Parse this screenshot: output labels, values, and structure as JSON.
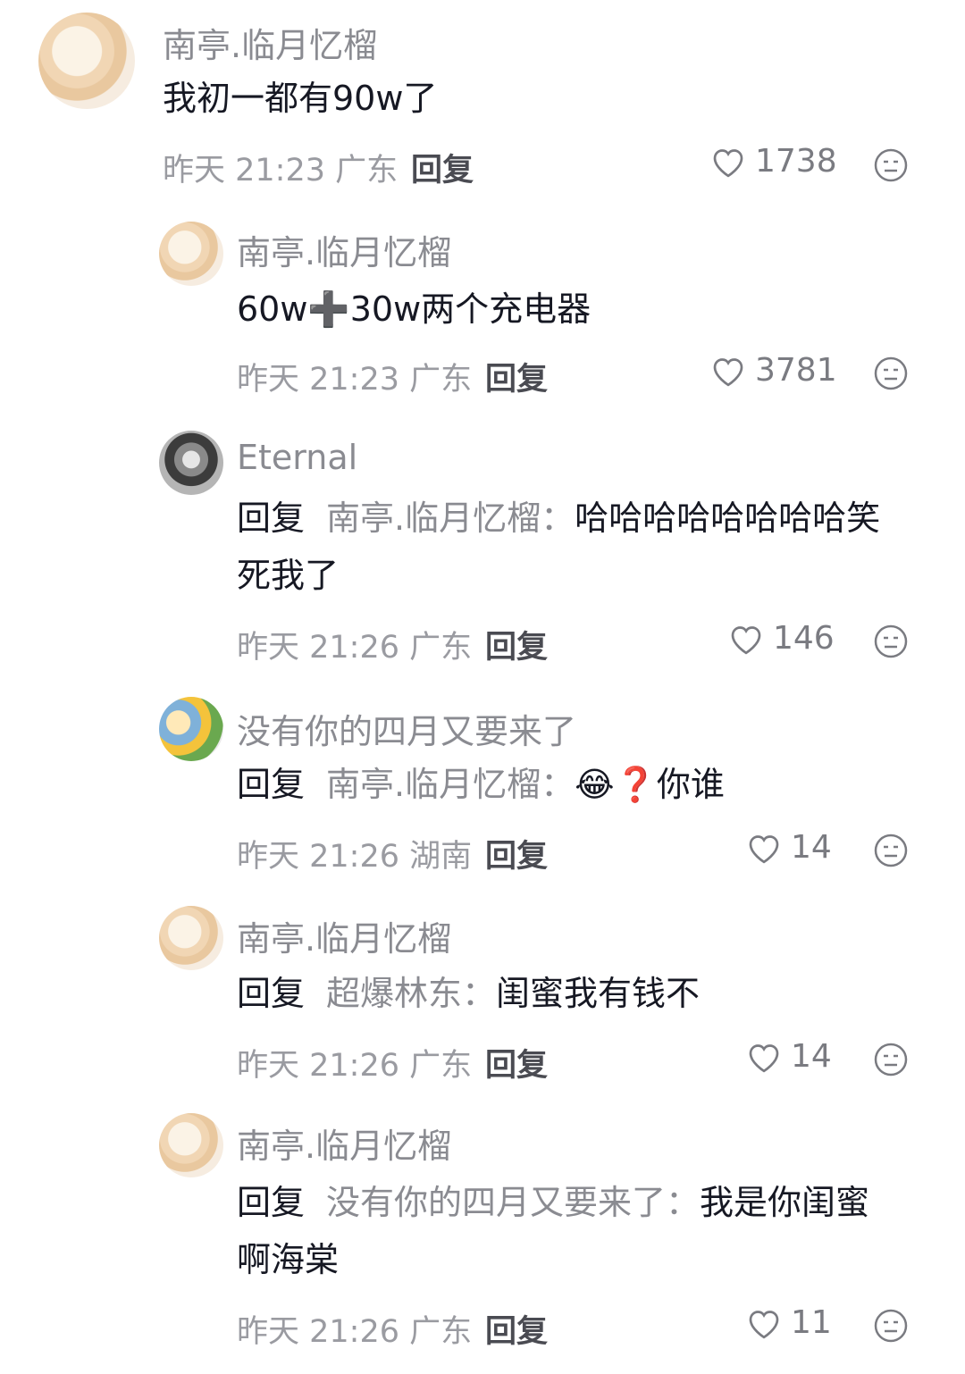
{
  "comments": [
    {
      "username": "南亭.临月忆榴",
      "text": "我初一都有90w了",
      "time_location": "昨天 21:23 广东",
      "reply_label": "回复",
      "likes": "1738",
      "avatar": "anime-girl-avatar"
    },
    {
      "username": "南亭.临月忆榴",
      "text": "60w➕30w两个充电器",
      "time_location": "昨天 21:23 广东",
      "reply_label": "回复",
      "likes": "3781",
      "avatar": "anime-girl-avatar"
    },
    {
      "username": "Eternal",
      "reply_prefix": "回复",
      "reply_target": "南亭.临月忆榴：",
      "text_line1": "哈哈哈哈哈哈哈哈笑",
      "text_line2": "死我了",
      "time_location": "昨天 21:26 广东",
      "reply_label": "回复",
      "likes": "146",
      "avatar": "cat-avatar"
    },
    {
      "username": "没有你的四月又要来了",
      "reply_prefix": "回复",
      "reply_target": "南亭.临月忆榴：",
      "text": "😂❓你谁",
      "time_location": "昨天 21:26 湖南",
      "reply_label": "回复",
      "likes": "14",
      "avatar": "anime-sunflower-avatar"
    },
    {
      "username": "南亭.临月忆榴",
      "reply_prefix": "回复",
      "reply_target": "超爆林东：",
      "text": "闺蜜我有钱不",
      "time_location": "昨天 21:26 广东",
      "reply_label": "回复",
      "likes": "14",
      "avatar": "anime-girl-avatar"
    },
    {
      "username": "南亭.临月忆榴",
      "reply_prefix": "回复",
      "reply_target": "没有你的四月又要来了：",
      "text_line1": "我是你闺蜜",
      "text_line2": "啊海棠",
      "time_location": "昨天 21:26 广东",
      "reply_label": "回复",
      "likes": "11",
      "avatar": "anime-girl-avatar"
    }
  ],
  "icons": {
    "like": "heart-outline-icon",
    "dislike": "meh-face-icon"
  },
  "colors": {
    "username": "#8a8b91",
    "text": "#161823",
    "meta": "#9a9ba1"
  }
}
